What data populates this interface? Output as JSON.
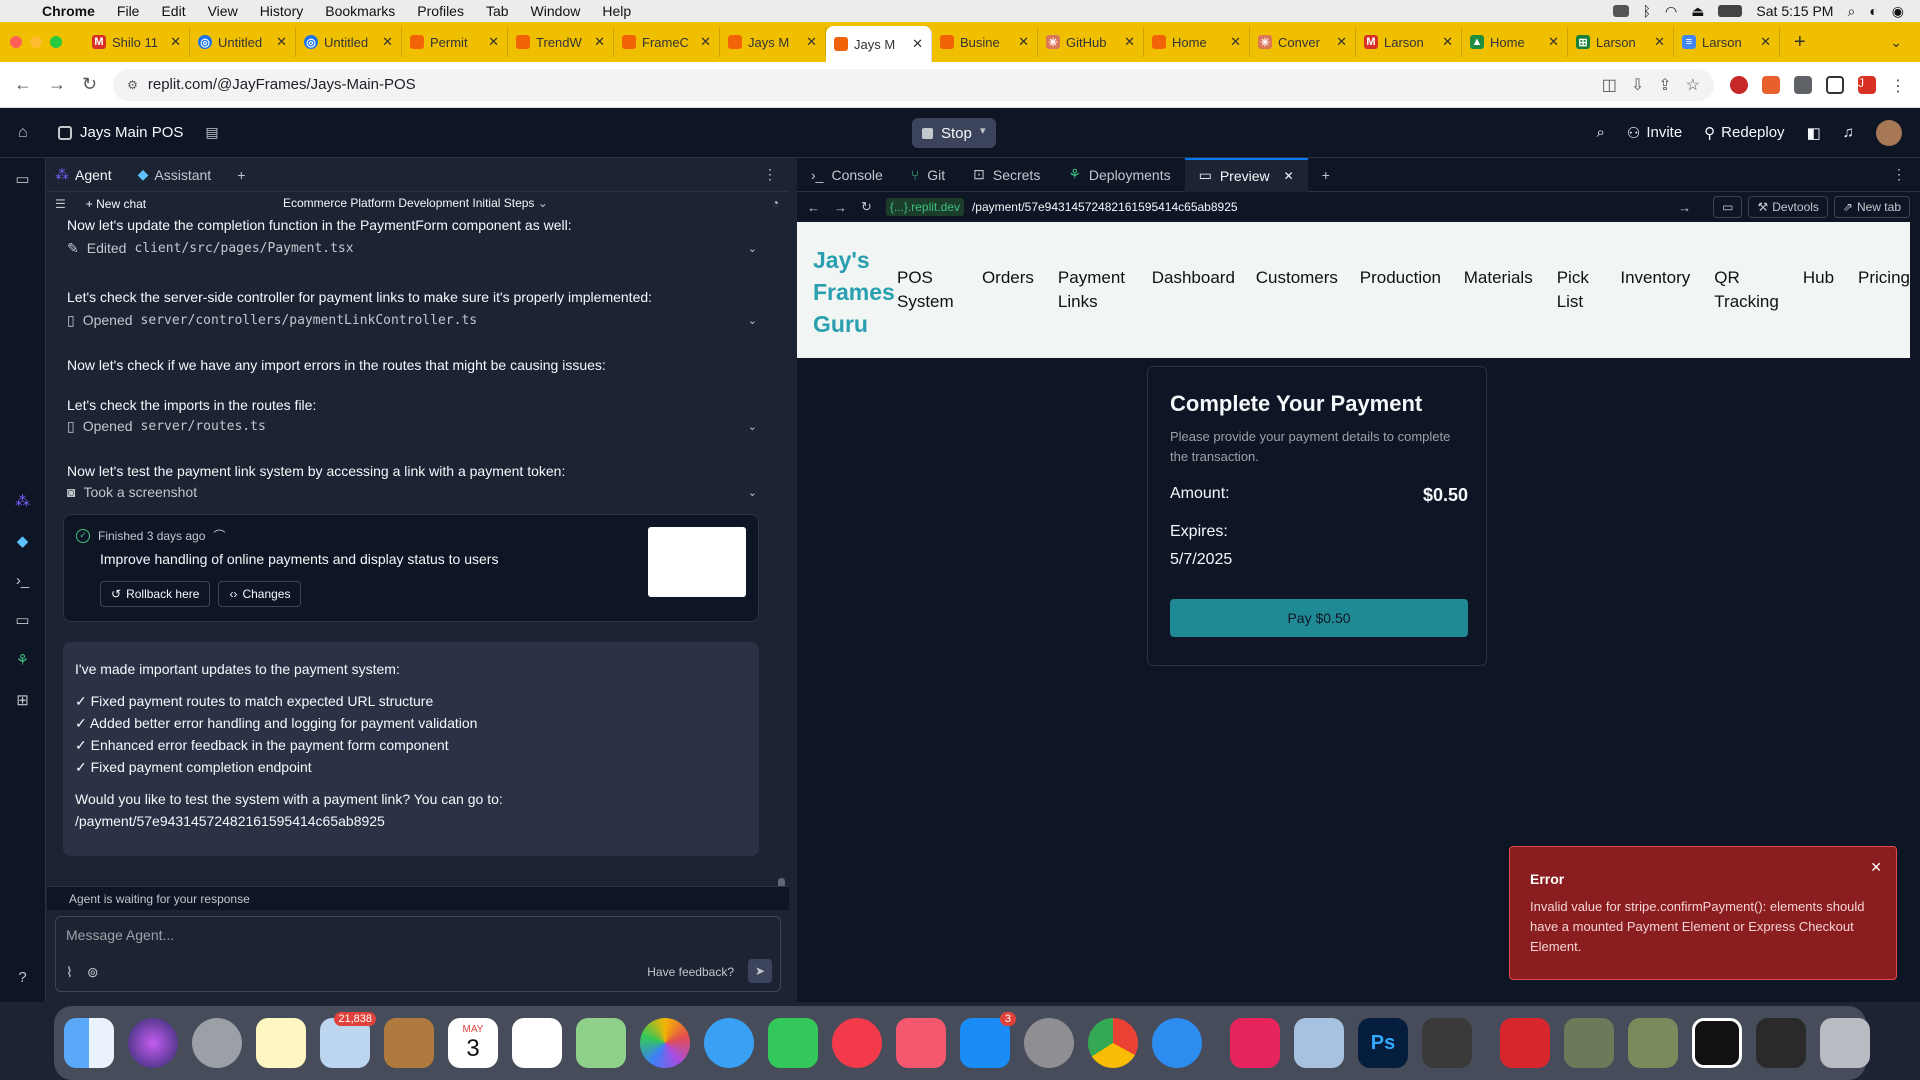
{
  "menubar": {
    "app": "Chrome",
    "items": [
      "File",
      "Edit",
      "View",
      "History",
      "Bookmarks",
      "Profiles",
      "Tab",
      "Window",
      "Help"
    ],
    "clock": "Sat 5:15 PM"
  },
  "browser": {
    "tabs": [
      {
        "label": "Shilo 11",
        "icon": "gmail-icon",
        "color": "#d93025"
      },
      {
        "label": "Untitled",
        "icon": "globe-icon",
        "color": "#1a73e8"
      },
      {
        "label": "Untitled",
        "icon": "globe-icon",
        "color": "#1a73e8"
      },
      {
        "label": "Permit",
        "icon": "replit-icon",
        "color": "#f26207"
      },
      {
        "label": "TrendW",
        "icon": "replit-icon",
        "color": "#f26207"
      },
      {
        "label": "FrameC",
        "icon": "replit-icon",
        "color": "#f26207"
      },
      {
        "label": "Jays M",
        "icon": "replit-icon",
        "color": "#f26207"
      },
      {
        "label": "Jays M",
        "icon": "replit-icon",
        "color": "#f26207",
        "active": true
      },
      {
        "label": "Busine",
        "icon": "replit-icon",
        "color": "#f26207"
      },
      {
        "label": "GitHub",
        "icon": "claude-icon",
        "color": "#d97757"
      },
      {
        "label": "Home",
        "icon": "replit-icon",
        "color": "#f26207"
      },
      {
        "label": "Conver",
        "icon": "claude-icon",
        "color": "#d97757"
      },
      {
        "label": "Larson",
        "icon": "gmail-icon",
        "color": "#d93025"
      },
      {
        "label": "Home",
        "icon": "drive-icon",
        "color": "#1e8e3e"
      },
      {
        "label": "Larson",
        "icon": "sheets-icon",
        "color": "#188038"
      },
      {
        "label": "Larson",
        "icon": "docs-icon",
        "color": "#4285f4"
      }
    ],
    "url": "replit.com/@JayFrames/Jays-Main-POS",
    "profile_initial": "J"
  },
  "workspace": {
    "project_name": "Jays Main POS",
    "stop_label": "Stop",
    "invite_label": "Invite",
    "redeploy_label": "Redeploy"
  },
  "agent_panel": {
    "tabs": {
      "agent": "Agent",
      "assistant": "Assistant"
    },
    "new_chat": "New chat",
    "chat_title": "Ecommerce Platform Development Initial Steps",
    "messages": {
      "m1": "Now let's update the completion function in the PaymentForm component as well:",
      "a1_verb": "Edited",
      "a1_file": "client/src/pages/Payment.tsx",
      "m2": "Let's check the server-side controller for payment links to make sure it's properly implemented:",
      "a2_verb": "Opened",
      "a2_file": "server/controllers/paymentLinkController.ts",
      "m3": "Now let's check if we have any import errors in the routes that might be causing issues:",
      "m4": "Let's check the imports in the routes file:",
      "a3_verb": "Opened",
      "a3_file": "server/routes.ts",
      "m5": "Now let's test the payment link system by accessing a link with a payment token:",
      "a4_label": "Took a screenshot"
    },
    "finished": {
      "status": "Finished 3 days ago",
      "summary": "Improve handling of online payments and display status to users",
      "rollback": "Rollback here",
      "changes": "Changes"
    },
    "summary_msg": {
      "intro": "I've made important updates to the payment system:",
      "points": [
        "✓ Fixed payment routes to match expected URL structure",
        "✓ Added better error handling and logging for payment validation",
        "✓ Enhanced error feedback in the payment form component",
        "✓ Fixed payment completion endpoint"
      ],
      "question": "Would you like to test the system with a payment link? You can go to:",
      "link": "/payment/57e94314572482161595414c65ab8925"
    },
    "waiting": "Agent is waiting for your response",
    "input_placeholder": "Message Agent...",
    "feedback": "Have feedback?"
  },
  "right_panel": {
    "tabs": [
      "Console",
      "Git",
      "Secrets",
      "Deployments",
      "Preview"
    ],
    "url_chip": "{...}.replit.dev",
    "url_path": "/payment/57e94314572482161595414c65ab8925",
    "devtools": "Devtools",
    "new_tab": "New tab"
  },
  "app": {
    "brand": "Jay's Frames Guru",
    "nav": [
      "POS System",
      "Orders",
      "Payment Links",
      "Dashboard",
      "Customers",
      "Production",
      "Materials",
      "Pick List",
      "Inventory",
      "QR Tracking",
      "Hub",
      "Pricing"
    ],
    "payment": {
      "title": "Complete Your Payment",
      "subtitle": "Please provide your payment details to complete the transaction.",
      "amount_label": "Amount:",
      "amount_value": "$0.50",
      "expires_label": "Expires:",
      "expires_value": "5/7/2025",
      "pay_button": "Pay $0.50"
    },
    "error_toast": {
      "title": "Error",
      "body": "Invalid value for stripe.confirmPayment(): elements should have a mounted Payment Element or Express Checkout Element."
    }
  },
  "dock": {
    "apps": [
      "finder-icon",
      "siri-icon",
      "launchpad-icon",
      "notes-icon",
      "mail-icon",
      "contacts-icon",
      "calendar-icon",
      "reminders-icon",
      "maps-icon",
      "photos-icon",
      "messages-icon",
      "facetime-icon",
      "news-icon",
      "music-icon",
      "appstore-icon",
      "settings-icon",
      "chrome-icon",
      "safari-icon",
      "creativecloud-icon",
      "preview-icon",
      "photoshop-icon",
      "photo-icon",
      "acrobat-icon",
      "image-icon",
      "image-icon",
      "qr-icon",
      "window-icon",
      "trash-icon"
    ],
    "mail_badge": "21,838",
    "calendar_month": "MAY",
    "calendar_day": "3",
    "appstore_badge": "3"
  }
}
